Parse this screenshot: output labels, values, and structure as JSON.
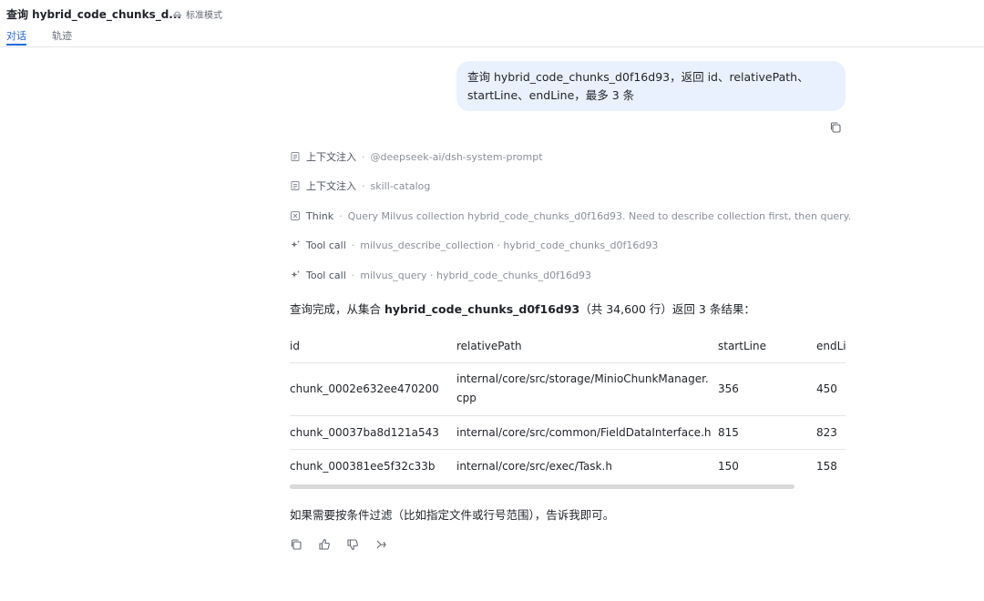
{
  "header": {
    "title": "查询 hybrid_code_chunks_d...",
    "mode": "标准模式",
    "tabs": [
      {
        "label": "对话",
        "active": true
      },
      {
        "label": "轨迹",
        "active": false
      }
    ]
  },
  "user_message": {
    "line1": "查询 hybrid_code_chunks_d0f16d93，返回 id、relativePath、",
    "line2": "startLine、endLine，最多 3 条"
  },
  "steps": [
    {
      "icon": "document-icon",
      "label": "上下文注入",
      "detail": "@deepseek-ai/dsh-system-prompt"
    },
    {
      "icon": "document-icon",
      "label": "上下文注入",
      "detail": "skill-catalog"
    },
    {
      "icon": "brain-icon",
      "label": "Think",
      "detail": "Query Milvus collection hybrid_code_chunks_d0f16d93. Need to describe collection first, then query."
    },
    {
      "icon": "sparkle-icon",
      "label": "Tool call",
      "detail": "milvus_describe_collection · hybrid_code_chunks_d0f16d93"
    },
    {
      "icon": "sparkle-icon",
      "label": "Tool call",
      "detail": "milvus_query · hybrid_code_chunks_d0f16d93"
    }
  ],
  "separator": "·",
  "answer": {
    "prefix": "查询完成，从集合 ",
    "collection": "hybrid_code_chunks_d0f16d93",
    "suffix": "（共 34,600 行）返回 3 条结果："
  },
  "table": {
    "headers": [
      "id",
      "relativePath",
      "startLine",
      "endLine"
    ],
    "rows": [
      {
        "id": "chunk_0002e632ee470200",
        "path_line1": "internal/core/src/storage/MinioChunkManager.",
        "path_line2": "cpp",
        "start": "356",
        "end": "450"
      },
      {
        "id": "chunk_00037ba8d121a543",
        "path_line1": "internal/core/src/common/FieldDataInterface.h",
        "path_line2": "",
        "start": "815",
        "end": "823"
      },
      {
        "id": "chunk_000381ee5f32c33b",
        "path_line1": "internal/core/src/exec/Task.h",
        "path_line2": "",
        "start": "150",
        "end": "158"
      }
    ]
  },
  "followup": "如果需要按条件过滤（比如指定文件或行号范围），告诉我即可。",
  "colors": {
    "accent": "#2468d8",
    "bubble": "#eaf1fe",
    "muted": "#8a8f99"
  }
}
